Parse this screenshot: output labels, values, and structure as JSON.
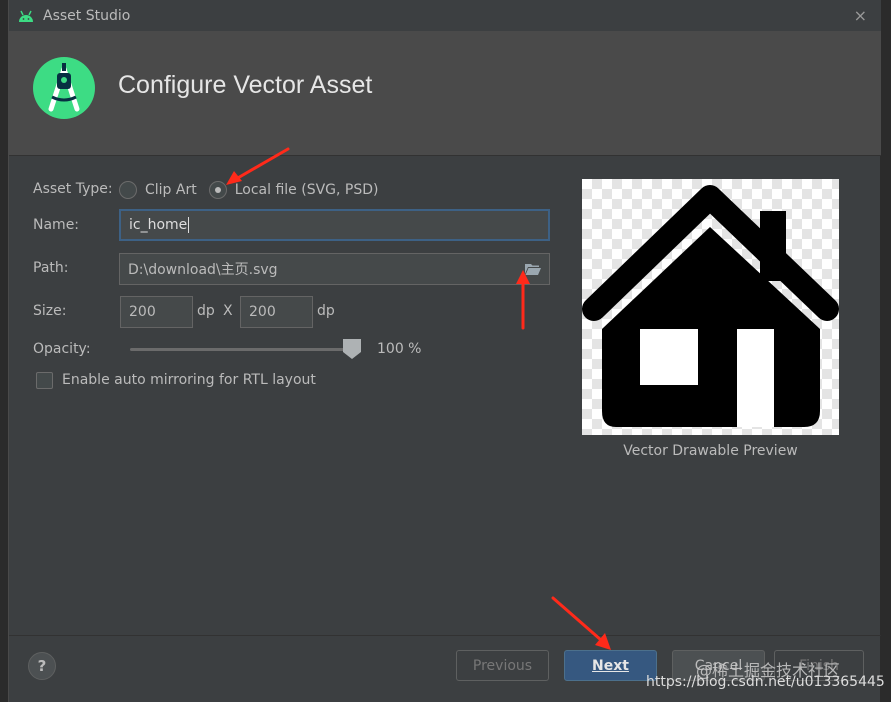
{
  "window": {
    "title": "Asset Studio",
    "close_glyph": "×"
  },
  "header": {
    "title": "Configure Vector Asset"
  },
  "form": {
    "asset_type_label": "Asset Type:",
    "asset_type_options": [
      {
        "label": "Clip Art",
        "selected": false
      },
      {
        "label": "Local file (SVG, PSD)",
        "selected": true
      }
    ],
    "name_label": "Name:",
    "name_value": "ic_home",
    "path_label": "Path:",
    "path_value": "D:\\download\\主页.svg",
    "size_label": "Size:",
    "width_value": "200",
    "height_value": "200",
    "unit_dp": "dp",
    "size_separator": "X",
    "opacity_label": "Opacity:",
    "opacity_value": "100 %",
    "opacity_fraction": 1.0,
    "rtl_mirroring_label": "Enable auto mirroring for RTL layout",
    "rtl_mirroring_checked": false
  },
  "preview": {
    "caption": "Vector Drawable Preview"
  },
  "footer": {
    "help_label": "?",
    "previous_label": "Previous",
    "next_label": "Next",
    "cancel_label": "Cancel",
    "finish_label": "Finish"
  },
  "watermark": {
    "line1": "@稀土掘金技术社区",
    "line2": "https://blog.csdn.net/u013365445"
  },
  "colors": {
    "dialog_bg": "#3c3f41",
    "header_bg": "#4a4a4a",
    "primary_button": "#365880",
    "annotation_arrow": "#ff2a1a",
    "logo_green": "#3ddc84"
  }
}
